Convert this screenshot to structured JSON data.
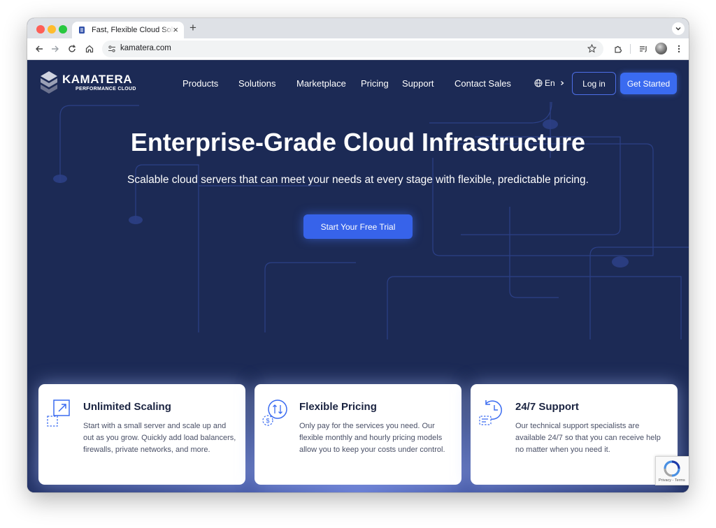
{
  "browser": {
    "tab_title": "Fast, Flexible Cloud Solutions",
    "new_tab_symbol": "+",
    "close_symbol": "×",
    "url": "kamatera.com"
  },
  "brand": {
    "name": "KAMATERA",
    "tagline": "PERFORMANCE CLOUD"
  },
  "nav": {
    "items": [
      {
        "label": "Products"
      },
      {
        "label": "Solutions"
      },
      {
        "label": "Marketplace"
      },
      {
        "label": "Pricing"
      },
      {
        "label": "Support"
      },
      {
        "label": "Contact Sales"
      }
    ],
    "language": "En",
    "login": "Log in",
    "get_started": "Get Started"
  },
  "hero": {
    "title": "Enterprise-Grade Cloud Infrastructure",
    "subtitle": "Scalable cloud servers that can meet your needs at every stage with flexible, predictable pricing.",
    "cta": "Start Your Free Trial"
  },
  "features": [
    {
      "icon": "scaling-icon",
      "title": "Unlimited Scaling",
      "text": "Start with a small server and scale up and out as you grow. Quickly add load balancers, firewalls, private networks, and more."
    },
    {
      "icon": "pricing-icon",
      "title": "Flexible Pricing",
      "text": "Only pay for the services you need. Our flexible monthly and hourly pricing models allow you to keep your costs under control."
    },
    {
      "icon": "support-icon",
      "title": "24/7 Support",
      "text": "Our technical support specialists are available 24/7 so that you can receive help no matter when you need it."
    }
  ],
  "recaptcha": {
    "text": "Privacy - Terms"
  },
  "colors": {
    "page_background": "#1c2a55",
    "accent": "#3a6bf0",
    "card_title": "#1b2441"
  }
}
